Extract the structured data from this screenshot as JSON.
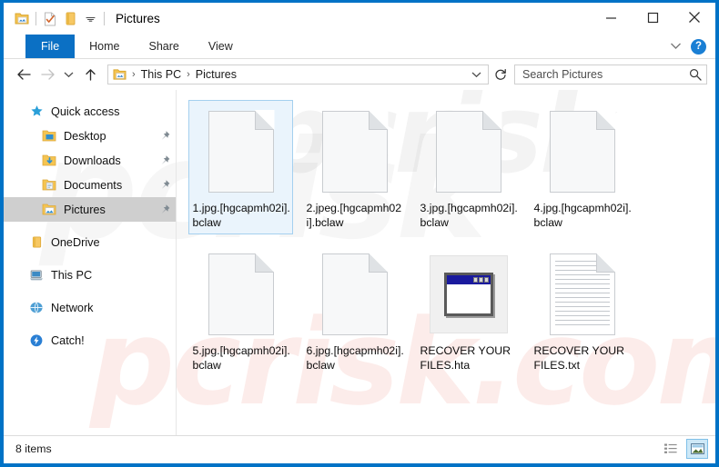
{
  "window": {
    "title": "Pictures",
    "border_color": "#0072c6",
    "quick_access_toolbar": [
      {
        "name": "explorer-icon",
        "label": "File Explorer"
      },
      {
        "name": "properties-icon",
        "label": "Properties"
      },
      {
        "name": "new-folder-icon",
        "label": "New folder"
      },
      {
        "name": "customize-qat-caret-icon",
        "label": "Customize Quick Access Toolbar"
      }
    ],
    "controls": {
      "minimize": "Minimize",
      "maximize": "Maximize",
      "close": "Close"
    }
  },
  "ribbon": {
    "tabs": [
      {
        "label": "File",
        "active": true
      },
      {
        "label": "Home",
        "active": false
      },
      {
        "label": "Share",
        "active": false
      },
      {
        "label": "View",
        "active": false
      }
    ],
    "expand_label": "Expand the Ribbon",
    "help_label": "?",
    "accent_color": "#0b70c4"
  },
  "address": {
    "back_label": "Back",
    "forward_label": "Forward",
    "recent_label": "Recent locations",
    "up_label": "Up",
    "breadcrumb": [
      "This PC",
      "Pictures"
    ],
    "separator": "›",
    "dropdown_label": "Previous locations",
    "refresh_label": "Refresh"
  },
  "search": {
    "placeholder": "Search Pictures",
    "value": ""
  },
  "sidebar": {
    "items": [
      {
        "label": "Quick access",
        "icon": "star-icon",
        "level": 0,
        "pinned": false,
        "selected": false,
        "gap_before": false
      },
      {
        "label": "Desktop",
        "icon": "folder-desktop-icon",
        "level": 1,
        "pinned": true,
        "selected": false,
        "gap_before": false
      },
      {
        "label": "Downloads",
        "icon": "folder-downloads-icon",
        "level": 1,
        "pinned": true,
        "selected": false,
        "gap_before": false
      },
      {
        "label": "Documents",
        "icon": "folder-documents-icon",
        "level": 1,
        "pinned": true,
        "selected": false,
        "gap_before": false
      },
      {
        "label": "Pictures",
        "icon": "folder-pictures-icon",
        "level": 1,
        "pinned": true,
        "selected": true,
        "gap_before": false
      },
      {
        "label": "OneDrive",
        "icon": "onedrive-icon",
        "level": 0,
        "pinned": false,
        "selected": false,
        "gap_before": true
      },
      {
        "label": "This PC",
        "icon": "this-pc-icon",
        "level": 0,
        "pinned": false,
        "selected": false,
        "gap_before": true
      },
      {
        "label": "Network",
        "icon": "network-icon",
        "level": 0,
        "pinned": false,
        "selected": false,
        "gap_before": true
      },
      {
        "label": "Catch!",
        "icon": "catch-icon",
        "level": 0,
        "pinned": false,
        "selected": false,
        "gap_before": true
      }
    ]
  },
  "files": [
    {
      "name": "1.jpg.[hgcapmh02i].bclaw",
      "icon": "blank-document-icon",
      "selected": true
    },
    {
      "name": "2.jpeg.[hgcapmh02i].bclaw",
      "icon": "blank-document-icon",
      "selected": false
    },
    {
      "name": "3.jpg.[hgcapmh02i].bclaw",
      "icon": "blank-document-icon",
      "selected": false
    },
    {
      "name": "4.jpg.[hgcapmh02i].bclaw",
      "icon": "blank-document-icon",
      "selected": false
    },
    {
      "name": "5.jpg.[hgcapmh02i].bclaw",
      "icon": "blank-document-icon",
      "selected": false
    },
    {
      "name": "6.jpg.[hgcapmh02i].bclaw",
      "icon": "blank-document-icon",
      "selected": false
    },
    {
      "name": "RECOVER YOUR FILES.hta",
      "icon": "hta-application-icon",
      "selected": false
    },
    {
      "name": "RECOVER YOUR FILES.txt",
      "icon": "text-document-icon",
      "selected": false
    }
  ],
  "statusbar": {
    "item_count": "8 items",
    "details_view_label": "Details view",
    "large_icons_view_label": "Large icons view",
    "active_view": "large-icons"
  },
  "watermark": {
    "line1": "pcrisk",
    "line2": "pcrisk.com",
    "line3": "pcrisk"
  }
}
